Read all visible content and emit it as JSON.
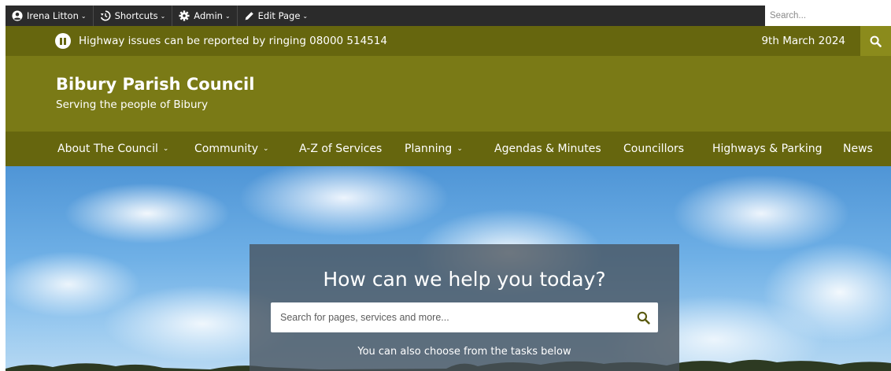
{
  "admin_bar": {
    "user": {
      "label": "Irena Litton",
      "icon": "user-circle-icon"
    },
    "shortcuts": {
      "label": "Shortcuts",
      "icon": "history-icon"
    },
    "admin": {
      "label": "Admin",
      "icon": "gear-icon"
    },
    "edit_page": {
      "label": "Edit Page",
      "icon": "pencil-icon"
    },
    "search_placeholder": "Search..."
  },
  "alert_bar": {
    "message": "Highway issues can be reported by ringing 08000 514514",
    "date": "9th March 2024",
    "pause_icon": "pause-icon",
    "search_icon": "search-icon"
  },
  "brand": {
    "title": "Bibury Parish Council",
    "subtitle": "Serving the people of Bibury"
  },
  "nav": {
    "items": [
      {
        "label": "About The Council",
        "dropdown": true
      },
      {
        "label": "Community",
        "dropdown": true
      },
      {
        "label": "A-Z of Services",
        "dropdown": false
      },
      {
        "label": "Planning",
        "dropdown": true
      },
      {
        "label": "Agendas & Minutes",
        "dropdown": false
      },
      {
        "label": "Councillors",
        "dropdown": false
      },
      {
        "label": "Highways & Parking",
        "dropdown": false
      },
      {
        "label": "News",
        "dropdown": false
      }
    ]
  },
  "hero": {
    "heading": "How can we help you today?",
    "search_placeholder": "Search for pages, services and more...",
    "tasks_text": "You can also choose from the tasks below"
  },
  "colors": {
    "toolbar": "#2b2b2b",
    "alert_bar": "#66660e",
    "brand_header": "#7a7a16",
    "nav_bar": "#66660e",
    "search_button": "#8b8b1c",
    "search_icon_hero": "#5a5a0f"
  }
}
